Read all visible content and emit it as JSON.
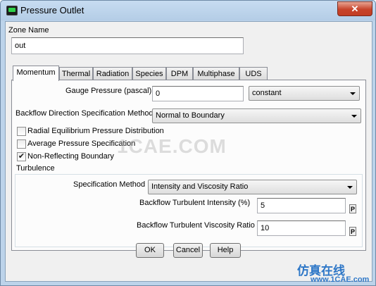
{
  "window": {
    "title": "Pressure Outlet",
    "close_label": "✕"
  },
  "zone": {
    "label": "Zone Name",
    "value": "out"
  },
  "tabs": [
    {
      "label": "Momentum",
      "active": true
    },
    {
      "label": "Thermal"
    },
    {
      "label": "Radiation"
    },
    {
      "label": "Species"
    },
    {
      "label": "DPM"
    },
    {
      "label": "Multiphase"
    },
    {
      "label": "UDS"
    }
  ],
  "momentum": {
    "gauge_pressure_label": "Gauge Pressure (pascal)",
    "gauge_pressure_value": "0",
    "gauge_pressure_profile": "constant",
    "backflow_dir_label": "Backflow Direction Specification Method",
    "backflow_dir_value": "Normal to Boundary",
    "options": [
      {
        "label": "Radial Equilibrium Pressure Distribution",
        "checked": false
      },
      {
        "label": "Average Pressure Specification",
        "checked": false
      },
      {
        "label": "Non-Reflecting Boundary",
        "checked": true
      }
    ],
    "turbulence": {
      "group_label": "Turbulence",
      "spec_method_label": "Specification Method",
      "spec_method_value": "Intensity and Viscosity Ratio",
      "intensity_label": "Backflow Turbulent Intensity (%)",
      "intensity_value": "5",
      "viscosity_label": "Backflow Turbulent Viscosity Ratio",
      "viscosity_value": "10",
      "param_button_label": "P"
    }
  },
  "buttons": {
    "ok": "OK",
    "cancel": "Cancel",
    "help": "Help"
  },
  "watermark": {
    "center": "1CAE.COM",
    "corner_cn": "仿真在线",
    "corner_en": "www.1CAE.com"
  },
  "colors": {
    "close_button": "#c7432a",
    "dialog_bg": "#f0f0f0",
    "frame": "#bcd3ea",
    "watermark_logo": "#2e77c7"
  }
}
